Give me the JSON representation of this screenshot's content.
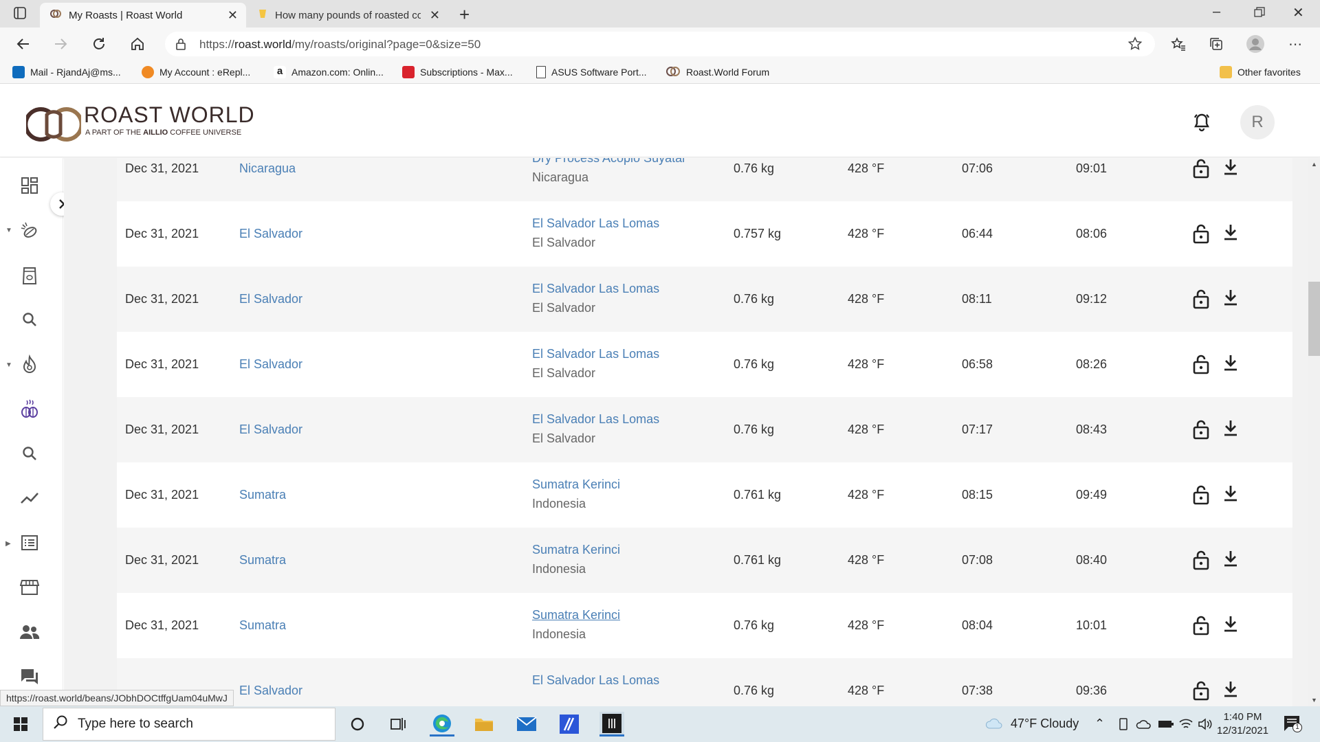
{
  "browser": {
    "tabs": [
      {
        "title": "My Roasts | Roast World",
        "active": true
      },
      {
        "title": "How many pounds of roasted co",
        "active": false
      }
    ],
    "url_prefix": "https://",
    "url_domain": "roast.world",
    "url_path": "/my/roasts/original?page=0&size=50",
    "favorites": [
      {
        "label": "Mail - RjandAj@ms...",
        "color": "#0f6cbd"
      },
      {
        "label": "My Account : eRepl...",
        "color": "#f08a24"
      },
      {
        "label": "Amazon.com: Onlin...",
        "color": "#222222"
      },
      {
        "label": "Subscriptions - Max...",
        "color": "#d9232d"
      },
      {
        "label": "ASUS Software Port...",
        "color": "#ffffff"
      },
      {
        "label": "Roast.World Forum",
        "color": "#6b4f4a"
      }
    ],
    "other_favorites": "Other favorites",
    "status_url": "https://roast.world/beans/JObhDOCtffgUam04uMwJ"
  },
  "app": {
    "logo_title": "ROAST WORLD",
    "logo_sub_prefix": "A PART OF THE ",
    "logo_sub_brand": "AILLIO",
    "logo_sub_suffix": " COFFEE UNIVERSE",
    "avatar_initial": "R",
    "accent": "#4a7fb5",
    "brand_color": "#3a2b2a"
  },
  "roasts": [
    {
      "date": "Dec 31, 2021",
      "name": "Nicaragua",
      "bean": "Dry Process Acopio Suyatal",
      "origin": "Nicaragua",
      "weight": "0.76 kg",
      "temp": "428 °F",
      "fc": "07:06",
      "total": "09:01"
    },
    {
      "date": "Dec 31, 2021",
      "name": "El Salvador",
      "bean": "El Salvador Las Lomas",
      "origin": "El Salvador",
      "weight": "0.757 kg",
      "temp": "428 °F",
      "fc": "06:44",
      "total": "08:06"
    },
    {
      "date": "Dec 31, 2021",
      "name": "El Salvador",
      "bean": "El Salvador Las Lomas",
      "origin": "El Salvador",
      "weight": "0.76 kg",
      "temp": "428 °F",
      "fc": "08:11",
      "total": "09:12"
    },
    {
      "date": "Dec 31, 2021",
      "name": "El Salvador",
      "bean": "El Salvador Las Lomas",
      "origin": "El Salvador",
      "weight": "0.76 kg",
      "temp": "428 °F",
      "fc": "06:58",
      "total": "08:26"
    },
    {
      "date": "Dec 31, 2021",
      "name": "El Salvador",
      "bean": "El Salvador Las Lomas",
      "origin": "El Salvador",
      "weight": "0.76 kg",
      "temp": "428 °F",
      "fc": "07:17",
      "total": "08:43"
    },
    {
      "date": "Dec 31, 2021",
      "name": "Sumatra",
      "bean": "Sumatra Kerinci",
      "origin": "Indonesia",
      "weight": "0.761 kg",
      "temp": "428 °F",
      "fc": "08:15",
      "total": "09:49"
    },
    {
      "date": "Dec 31, 2021",
      "name": "Sumatra",
      "bean": "Sumatra Kerinci",
      "origin": "Indonesia",
      "weight": "0.761 kg",
      "temp": "428 °F",
      "fc": "07:08",
      "total": "08:40"
    },
    {
      "date": "Dec 31, 2021",
      "name": "Sumatra",
      "bean": "Sumatra Kerinci",
      "origin": "Indonesia",
      "weight": "0.76 kg",
      "temp": "428 °F",
      "fc": "08:04",
      "total": "10:01"
    },
    {
      "date": "",
      "name": "El Salvador",
      "bean": "El Salvador Las Lomas",
      "origin": "",
      "weight": "0.76 kg",
      "temp": "428 °F",
      "fc": "07:38",
      "total": "09:36"
    }
  ],
  "taskbar": {
    "search_placeholder": "Type here to search",
    "weather": "47°F  Cloudy",
    "time": "1:40 PM",
    "date": "12/31/2021",
    "notifications": "1"
  }
}
